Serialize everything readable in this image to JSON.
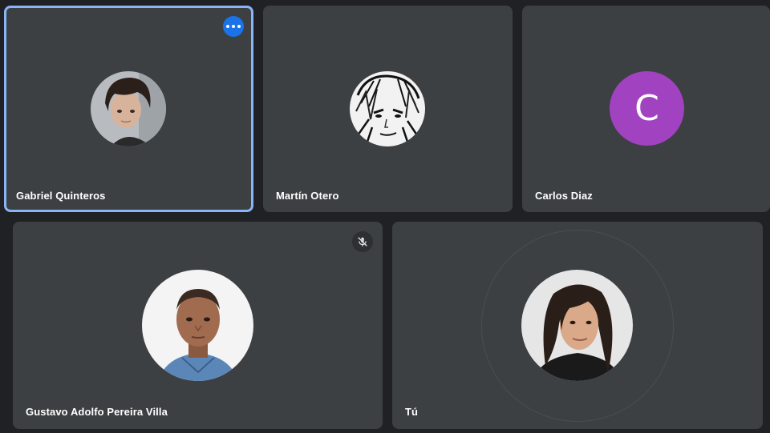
{
  "participants": [
    {
      "name": "Gabriel Quinteros",
      "avatar": "photo-young-man-dark-hair",
      "pinned_menu": "more-options",
      "active_speaker": true
    },
    {
      "name": "Martín Otero",
      "avatar": "manga-drawing"
    },
    {
      "name": "Carlos Diaz",
      "avatar_letter": "C",
      "avatar_color": "#a142c1"
    },
    {
      "name": "Gustavo Adolfo Pereira Villa",
      "avatar": "photo-man-blue-shirt",
      "muted": true
    },
    {
      "name": "Tú",
      "avatar": "photo-woman-dark-hair"
    }
  ],
  "colors": {
    "background": "#202124",
    "tile": "#3c4043",
    "active_border": "#8ab4f8",
    "more_button": "#1a73e8"
  },
  "icons": {
    "more": "more-horiz-icon",
    "mic_off": "mic-off-icon"
  }
}
